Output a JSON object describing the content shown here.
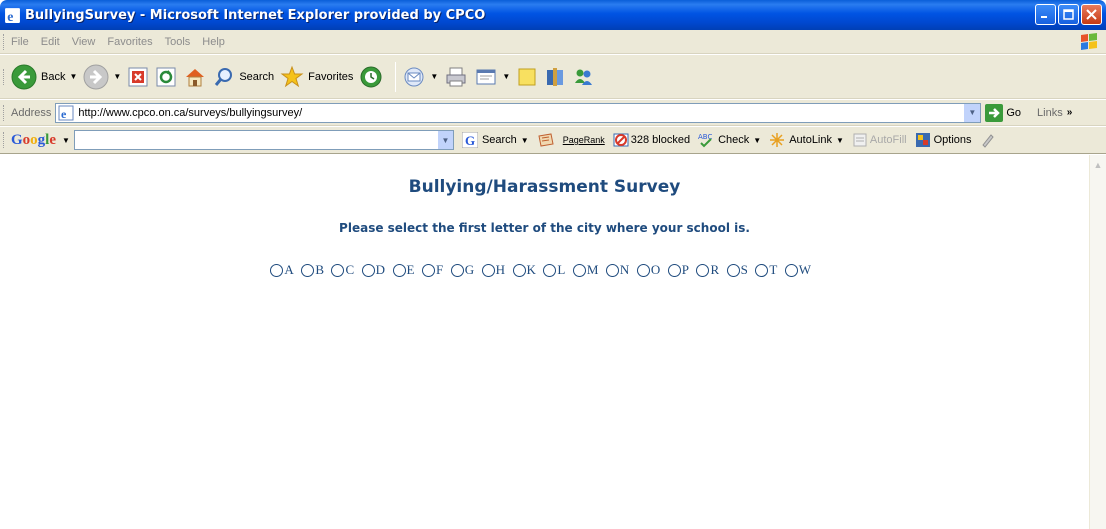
{
  "window": {
    "title": "BullyingSurvey - Microsoft Internet Explorer provided by CPCO"
  },
  "menu": {
    "items": [
      "File",
      "Edit",
      "View",
      "Favorites",
      "Tools",
      "Help"
    ]
  },
  "toolbar": {
    "back_label": "Back",
    "search_label": "Search",
    "favorites_label": "Favorites"
  },
  "address": {
    "label": "Address",
    "url": "http://www.cpco.on.ca/surveys/bullyingsurvey/",
    "go_label": "Go",
    "links_label": "Links"
  },
  "google": {
    "logo": "Google",
    "search_label": "Search",
    "pagerank_label": "PageRank",
    "blocked_label": "328 blocked",
    "check_label": "Check",
    "autolink_label": "AutoLink",
    "autofill_label": "AutoFill",
    "options_label": "Options"
  },
  "page": {
    "title": "Bullying/Harassment Survey",
    "instruction": "Please select the first letter of the city where your school is.",
    "letters": [
      "A",
      "B",
      "C",
      "D",
      "E",
      "F",
      "G",
      "H",
      "K",
      "L",
      "M",
      "N",
      "O",
      "P",
      "R",
      "S",
      "T",
      "W"
    ]
  },
  "colors": {
    "heading": "#1f4b7e",
    "titlebar": "#0054e3",
    "chrome": "#ece9d8"
  }
}
